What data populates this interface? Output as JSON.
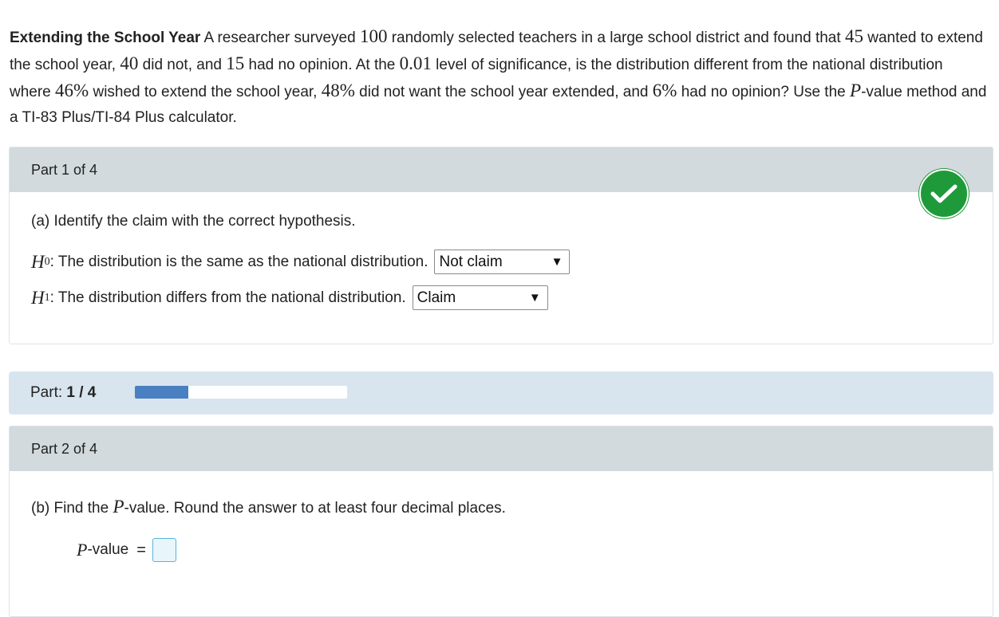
{
  "problem": {
    "title": "Extending the School Year",
    "s1": " A researcher surveyed ",
    "n1": "100",
    "s2": " randomly selected teachers in a large school district and found that ",
    "n2": "45",
    "s3": " wanted to extend the school year, ",
    "n3": "40",
    "s4": " did not, and ",
    "n4": "15",
    "s5": " had no opinion. At the ",
    "n5": "0.01",
    "s6": " level of significance, is the distribution different from the national distribution where ",
    "n6": "46%",
    "s7": " wished to extend the school year, ",
    "n7": "48%",
    "s8": " did not want the school year extended, and ",
    "n8": "6%",
    "s9": " had no opinion? Use the ",
    "p": "P",
    "s10": "-value method and a TI-83 Plus/TI-84 Plus calculator."
  },
  "part1": {
    "header": "Part 1 of 4",
    "status_icon": "checkmark-icon",
    "status_color": "#1f9a3a",
    "question": "(a) Identify the claim with the correct hypothesis.",
    "h0": {
      "symbol": "H",
      "sub": "0",
      "text": ": The distribution is the same as the national distribution.",
      "selected": "Not claim"
    },
    "h1": {
      "symbol": "H",
      "sub": "1",
      "text": ": The distribution differs from the national distribution.",
      "selected": "Claim"
    }
  },
  "progress": {
    "label": "Part: ",
    "value": "1 / 4",
    "fraction": 0.25,
    "fill_color": "#4a7fc1"
  },
  "part2": {
    "header": "Part 2 of 4",
    "question_pre": "(b) Find the ",
    "question_p": "P",
    "question_post": "-value. Round the answer to at least four decimal places.",
    "answer_label_p": "P",
    "answer_label_rest": "-value",
    "equals": "=",
    "answer_value": ""
  }
}
